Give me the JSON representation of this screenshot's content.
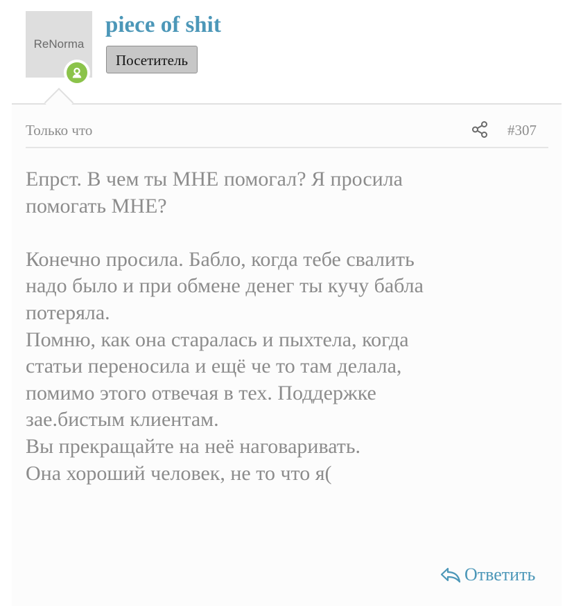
{
  "author": {
    "avatar_text": "ReNorma",
    "username": "piece of shit",
    "user_title": "Посетитель",
    "online_icon": "person-icon",
    "online_color": "#8bc34a"
  },
  "post": {
    "time": "Только что",
    "share_icon": "share-icon",
    "number": "#307",
    "message": "Епрст. В чем ты МНЕ помогал? Я просила\nпомогать МНЕ?\n\nКонечно просила. Бабло, когда тебе свалить\nнадо было и при обмене денег ты кучу бабла\nпотеряла.\nПомню, как она старалась и пыхтела, когда\nстатьи переносила и ещё че то там делала,\nпомимо этого отвечая в тех. Поддержке\nзае.бистым клиентам.\nВы прекращайте на неё наговаривать.\nОна хороший человек, не то что я(",
    "reply_label": "Ответить",
    "reply_icon": "reply-icon"
  },
  "colors": {
    "link": "#4c97b8",
    "muted_text": "#8c8c8c",
    "user_title_bg": "#c7c7c7"
  }
}
